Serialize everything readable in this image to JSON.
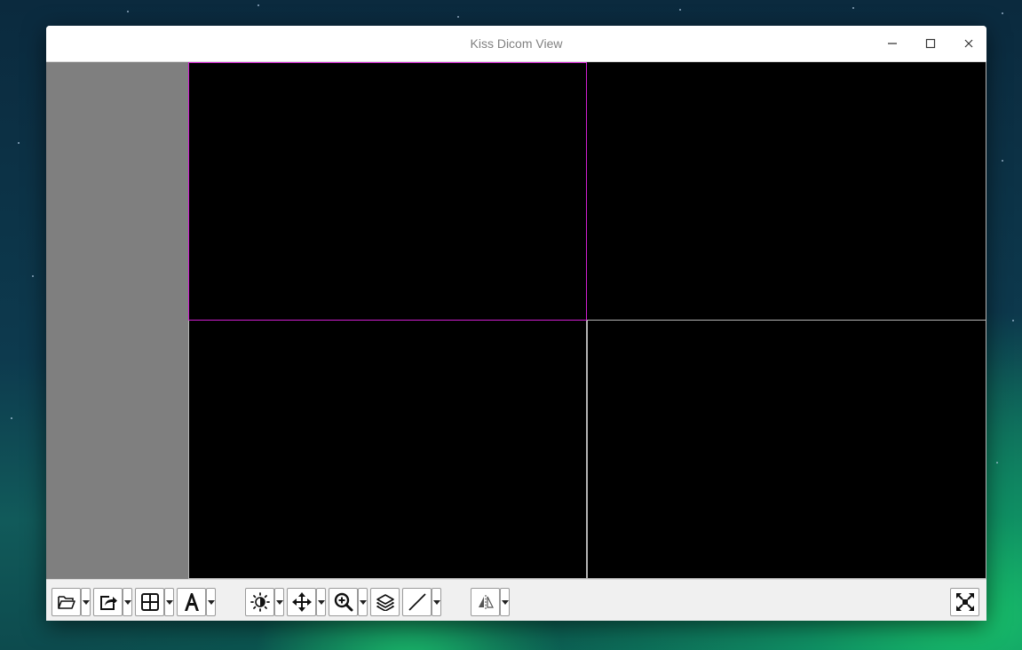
{
  "window": {
    "title": "Kiss Dicom View"
  },
  "title_controls": {
    "minimize": "minimize-icon",
    "maximize": "maximize-icon",
    "close": "close-icon"
  },
  "viewports": {
    "layout": "2x2",
    "active_index": 0,
    "active_border_color": "#d21fd2",
    "inactive_border_color": "#b4b4b4"
  },
  "toolbar": {
    "buttons": [
      {
        "name": "open-folder",
        "icon": "folder-open-icon",
        "has_dropdown": true
      },
      {
        "name": "export",
        "icon": "export-share-icon",
        "has_dropdown": true
      },
      {
        "name": "layout-grid",
        "icon": "grid-layout-icon",
        "has_dropdown": true
      },
      {
        "name": "text-annotation",
        "icon": "text-A-icon",
        "has_dropdown": true
      },
      {
        "name": "window-level",
        "icon": "brightness-contrast-icon",
        "has_dropdown": true
      },
      {
        "name": "pan",
        "icon": "move-arrows-icon",
        "has_dropdown": true
      },
      {
        "name": "zoom",
        "icon": "zoom-in-icon",
        "has_dropdown": true
      },
      {
        "name": "stack-layers",
        "icon": "layers-icon",
        "has_dropdown": false
      },
      {
        "name": "measure-line",
        "icon": "line-measure-icon",
        "has_dropdown": true
      },
      {
        "name": "flip",
        "icon": "flip-horizontal-icon",
        "has_dropdown": true
      },
      {
        "name": "fullscreen",
        "icon": "fullscreen-icon",
        "has_dropdown": false
      }
    ]
  },
  "colors": {
    "sidepanel": "#7f7f7f",
    "viewport_bg": "#000000",
    "toolbar_bg": "#f0f0f0"
  }
}
